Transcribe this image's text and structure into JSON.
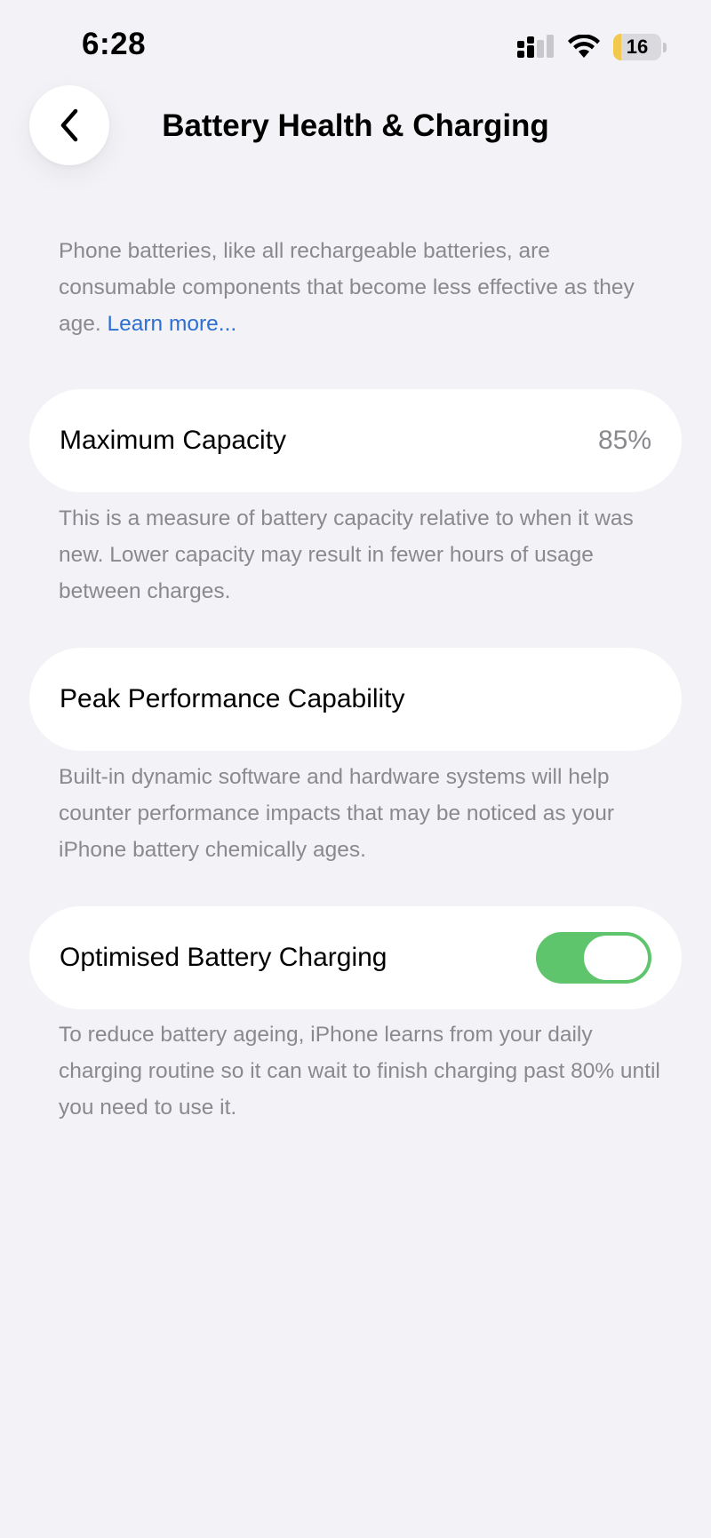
{
  "status_bar": {
    "time": "6:28",
    "battery_percent": "16",
    "battery_level_fraction": 0.16,
    "icons": [
      "cellular-signal-icon",
      "wifi-icon",
      "battery-icon"
    ]
  },
  "nav": {
    "back_icon": "chevron-left-icon",
    "title": "Battery Health & Charging"
  },
  "intro": {
    "text": "Phone batteries, like all rechargeable batteries, are consumable components that become less effective as they age.",
    "link": "Learn more..."
  },
  "max_capacity": {
    "label": "Maximum Capacity",
    "value": "85%",
    "footnote": "This is a measure of battery capacity relative to when it was new. Lower capacity may result in fewer hours of usage between charges."
  },
  "peak_performance": {
    "label": "Peak Performance Capability",
    "footnote": "Built-in dynamic software and hardware systems will help counter performance impacts that may be noticed as your iPhone battery chemically ages."
  },
  "optimised_charging": {
    "label": "Optimised Battery Charging",
    "enabled": true,
    "footnote": "To reduce battery ageing, iPhone learns from your daily charging routine so it can wait to finish charging past 80% until you need to use it."
  },
  "colors": {
    "background": "#f2f2f7",
    "card": "#ffffff",
    "secondary_text": "#8a8a8e",
    "link": "#2f6fd0",
    "toggle_on": "#5ec56c",
    "battery_low": "#f2c94c"
  }
}
